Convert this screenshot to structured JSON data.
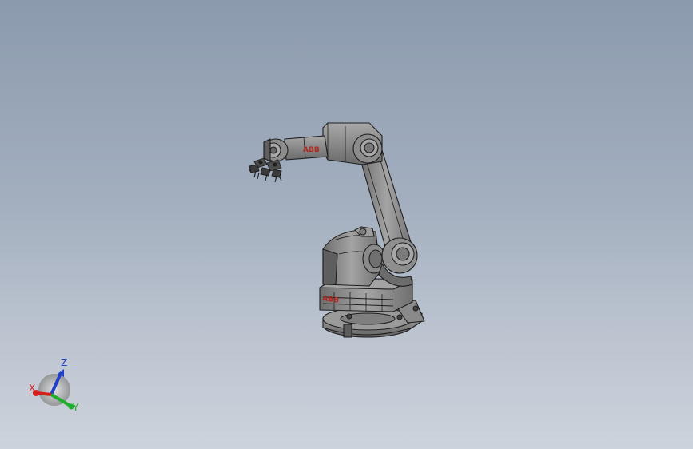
{
  "viewport": {
    "model_name": "robot-arm",
    "brand_mark": "ABB",
    "colors": {
      "metal_light": "#9a9a9a",
      "metal_mid": "#7c7c7c",
      "metal_dark": "#555555",
      "edge": "#1e1e1e",
      "brand_red": "#b3261e"
    }
  },
  "triad": {
    "x_label": "X",
    "y_label": "Y",
    "z_label": "Z",
    "x_color": "#d62020",
    "y_color": "#1fae2c",
    "z_color": "#2140c8"
  }
}
